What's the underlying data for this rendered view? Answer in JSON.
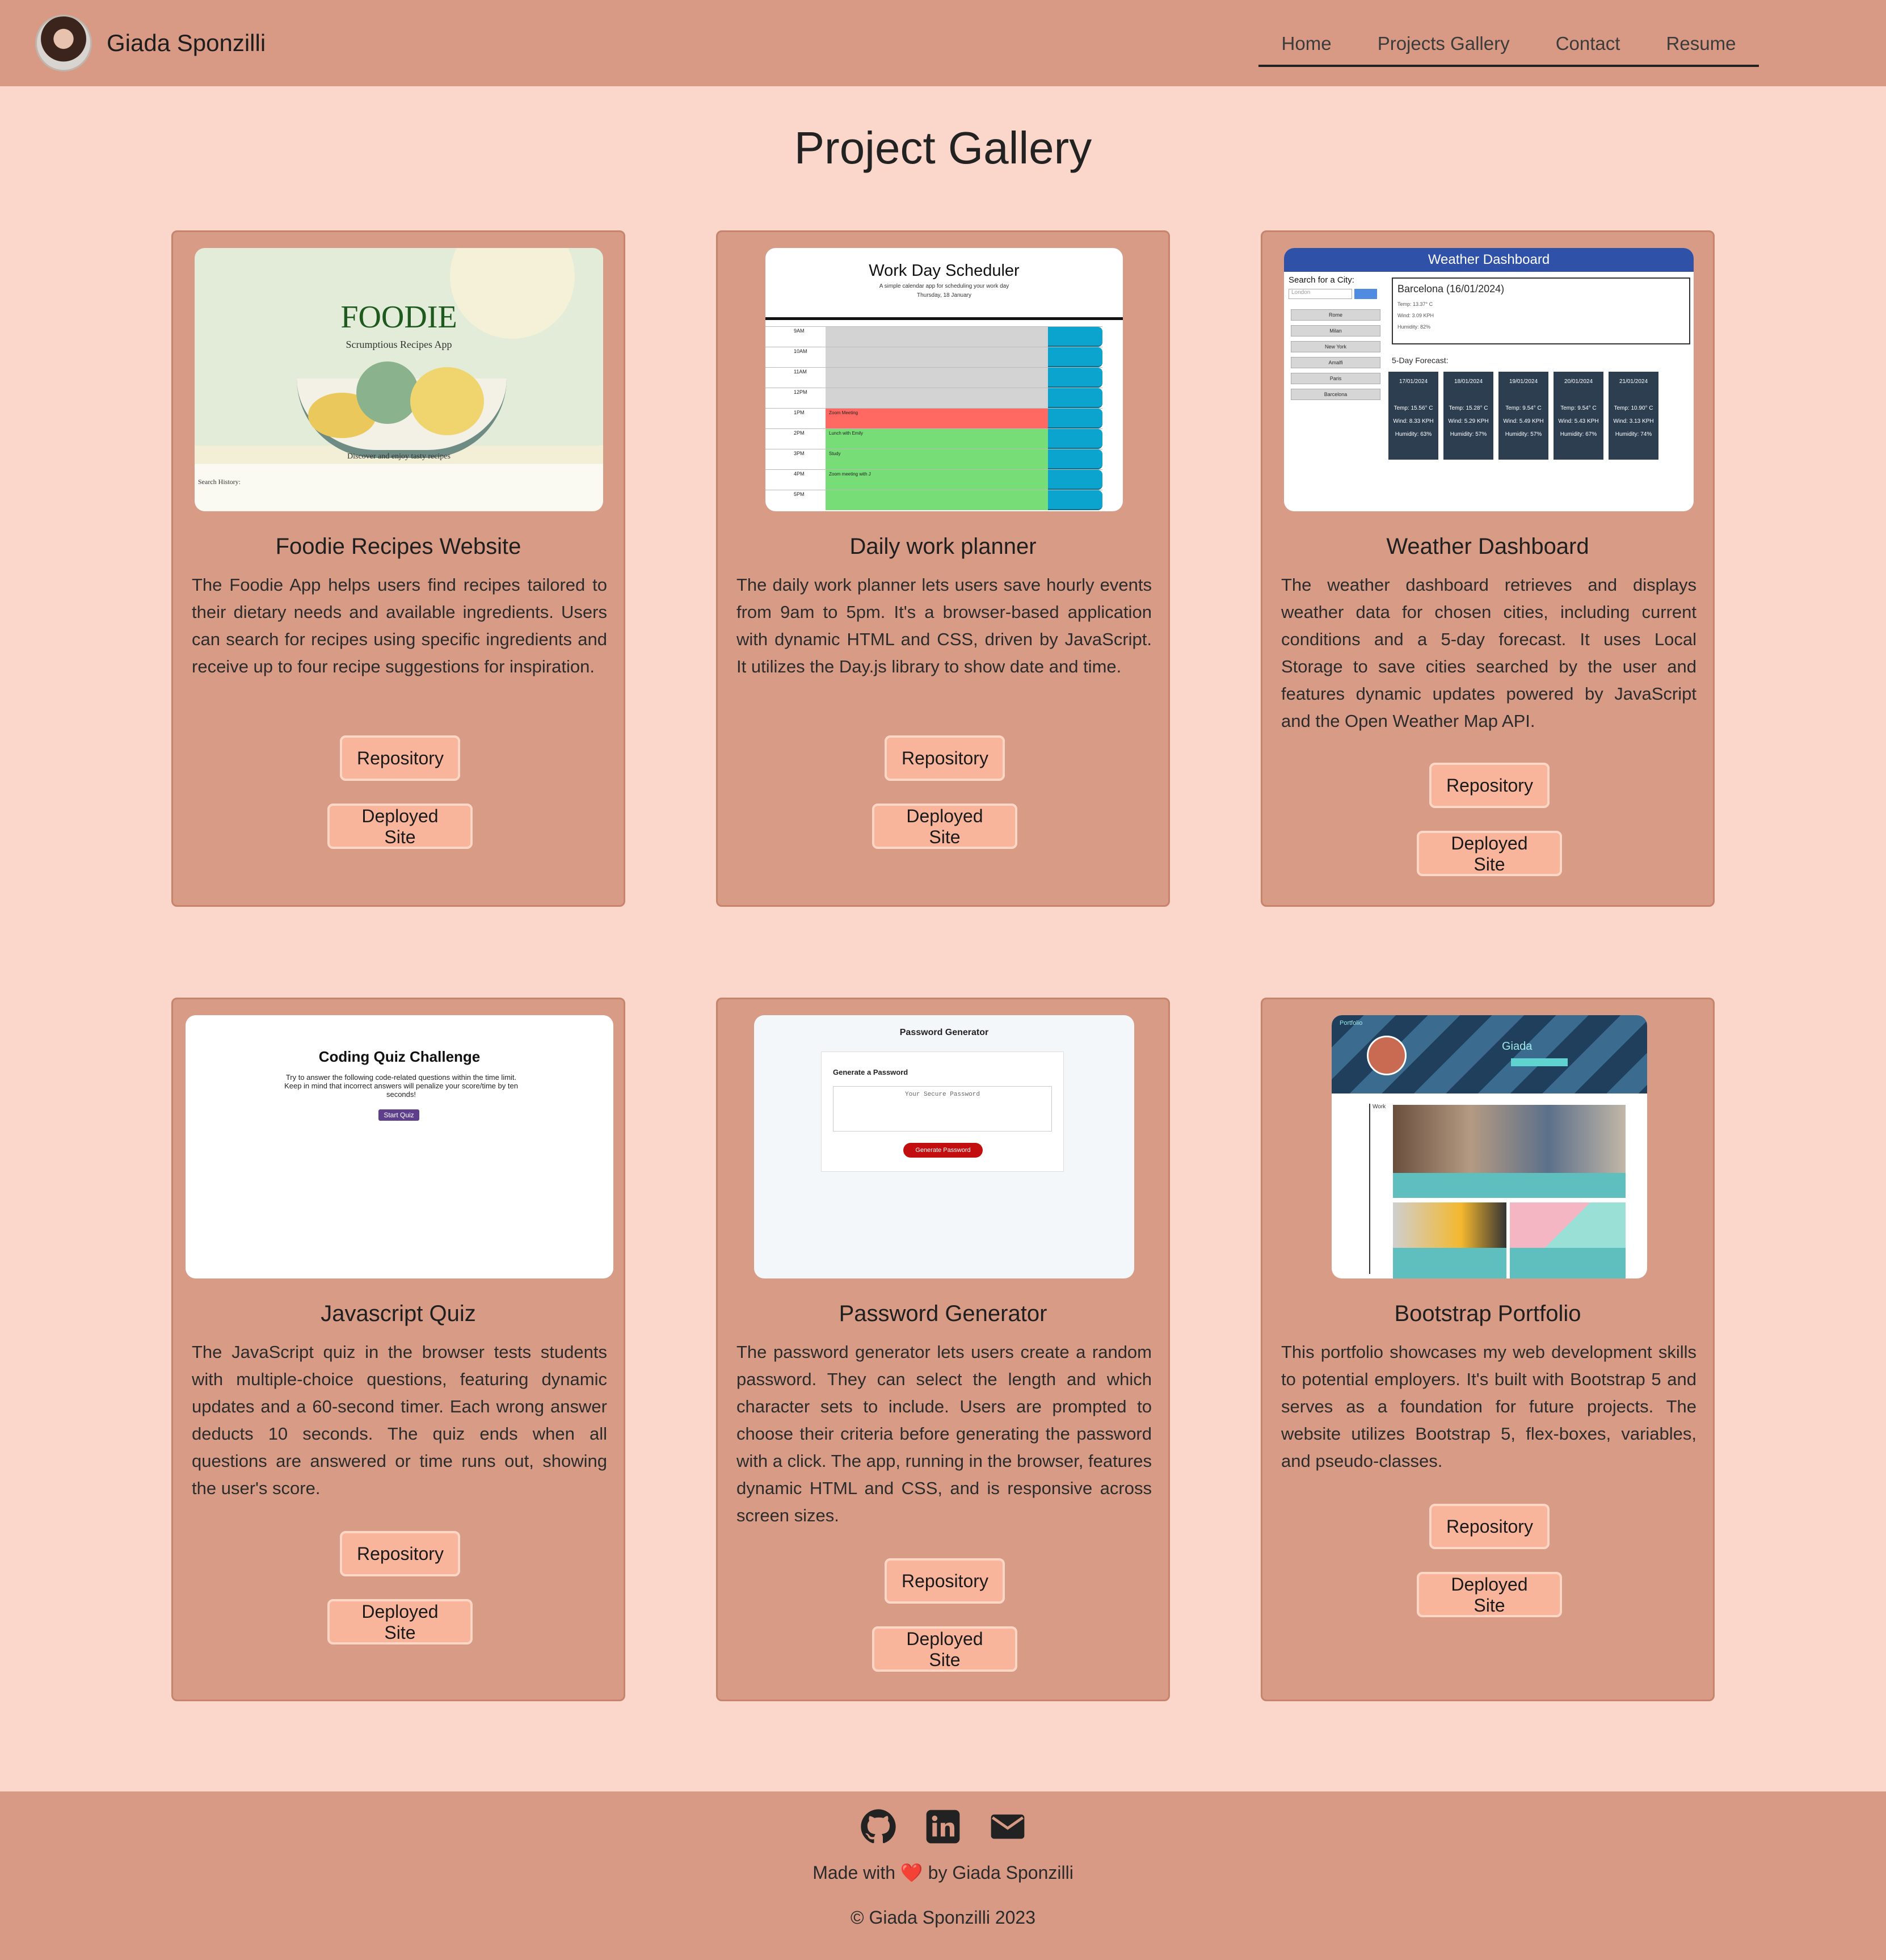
{
  "brand": {
    "name": "Giada Sponzilli"
  },
  "nav": {
    "items": [
      {
        "label": "Home"
      },
      {
        "label": "Projects Gallery"
      },
      {
        "label": "Contact"
      },
      {
        "label": "Resume"
      }
    ]
  },
  "page": {
    "title": "Project Gallery"
  },
  "projects": [
    {
      "title": "Foodie Recipes Website",
      "description": "The Foodie App helps users find recipes tailored to their dietary needs and available ingredients. Users can search for recipes using specific ingredients and receive up to four recipe suggestions for inspiration.",
      "repo_label": "Repository",
      "deploy_label": "Deployed Site",
      "preview": {
        "heading": "FOODIE",
        "subheading": "Scrumptious Recipes App",
        "tagline": "Discover and enjoy tasty recipes",
        "history_label": "Search History:"
      }
    },
    {
      "title": "Daily work planner",
      "description": "The daily work planner lets users save hourly events from 9am to 5pm. It's a browser-based application with dynamic HTML and CSS, driven by JavaScript. It utilizes the Day.js library to show date and time.",
      "repo_label": "Repository",
      "deploy_label": "Deployed Site",
      "preview": {
        "heading": "Work Day Scheduler",
        "subheading": "A simple calendar app for scheduling your work day",
        "date": "Thursday, 18 January",
        "rows": [
          {
            "hour": "9AM",
            "text": "",
            "color": "#d3d3d3"
          },
          {
            "hour": "10AM",
            "text": "",
            "color": "#d3d3d3"
          },
          {
            "hour": "11AM",
            "text": "",
            "color": "#d3d3d3"
          },
          {
            "hour": "12PM",
            "text": "",
            "color": "#d3d3d3"
          },
          {
            "hour": "1PM",
            "text": "Zoom Meeting",
            "color": "#ff6961"
          },
          {
            "hour": "2PM",
            "text": "Lunch with Emily",
            "color": "#77dd77"
          },
          {
            "hour": "3PM",
            "text": "Study",
            "color": "#77dd77"
          },
          {
            "hour": "4PM",
            "text": "Zoom meeting with J",
            "color": "#77dd77"
          },
          {
            "hour": "5PM",
            "text": "",
            "color": "#77dd77"
          }
        ]
      }
    },
    {
      "title": "Weather Dashboard",
      "description": "The weather dashboard retrieves and displays weather data for chosen cities, including current conditions and a 5-day forecast. It uses Local Storage to save cities searched by the user and features dynamic updates powered by JavaScript and the Open Weather Map API.",
      "repo_label": "Repository",
      "deploy_label": "Deployed Site",
      "preview": {
        "heading": "Weather Dashboard",
        "search_label": "Search for a City:",
        "search_placeholder": "London",
        "cities": [
          "Rome",
          "Milan",
          "New York",
          "Amalfi",
          "Paris",
          "Barcelona"
        ],
        "current": "Barcelona (16/01/2024)",
        "current_lines": [
          "Temp: 13.37° C",
          "Wind: 3.09 KPH",
          "Humidity: 82%"
        ],
        "forecast_label": "5-Day Forecast:",
        "forecast": [
          {
            "date": "17/01/2024",
            "temp": "Temp: 15.56° C",
            "wind": "Wind: 8.33 KPH",
            "humidity": "Humidity: 63%"
          },
          {
            "date": "18/01/2024",
            "temp": "Temp: 15.28° C",
            "wind": "Wind: 5.29 KPH",
            "humidity": "Humidity: 57%"
          },
          {
            "date": "19/01/2024",
            "temp": "Temp: 9.54° C",
            "wind": "Wind: 5.49 KPH",
            "humidity": "Humidity: 57%"
          },
          {
            "date": "20/01/2024",
            "temp": "Temp: 9.54° C",
            "wind": "Wind: 5.43 KPH",
            "humidity": "Humidity: 67%"
          },
          {
            "date": "21/01/2024",
            "temp": "Temp: 10.90° C",
            "wind": "Wind: 3.13 KPH",
            "humidity": "Humidity: 74%"
          }
        ]
      }
    },
    {
      "title": "Javascript Quiz",
      "description": "The JavaScript quiz in the browser tests students with multiple-choice questions, featuring dynamic updates and a 60-second timer. Each wrong answer deducts 10 seconds. The quiz ends when all questions are answered or time runs out, showing the user's score.",
      "repo_label": "Repository",
      "deploy_label": "Deployed Site",
      "preview": {
        "heading": "Coding Quiz Challenge",
        "text": "Try to answer the following code-related questions within the time limit. Keep in mind that incorrect answers will penalize your score/time by ten seconds!",
        "button": "Start Quiz"
      }
    },
    {
      "title": "Password Generator",
      "description": "The password generator lets users create a random password. They can select the length and which character sets to include. Users are prompted to choose their criteria before generating the password with a click. The app, running in the browser, features dynamic HTML and CSS, and is responsive across screen sizes.",
      "repo_label": "Repository",
      "deploy_label": "Deployed Site",
      "preview": {
        "heading": "Password Generator",
        "card_label": "Generate a Password",
        "placeholder": "Your Secure Password",
        "button": "Generate Password"
      }
    },
    {
      "title": "Bootstrap Portfolio",
      "description": "This portfolio showcases my web development skills to potential employers. It's built with Bootstrap 5 and serves as a foundation for future projects. The website utilizes Bootstrap 5, flex-boxes, variables, and pseudo-classes.",
      "repo_label": "Repository",
      "deploy_label": "Deployed Site",
      "preview": {
        "brand": "Portfolio",
        "name": "Giada",
        "work_label": "Work"
      }
    }
  ],
  "footer": {
    "icons": [
      "github-icon",
      "linkedin-icon",
      "email-icon"
    ],
    "made_prefix": "Made with",
    "made_heart": "❤️",
    "made_suffix": "by Giada Sponzilli",
    "copyright": "© Giada Sponzilli 2023"
  },
  "colors": {
    "page_bg": "#fbd7cb",
    "nav_bg": "#d89a85",
    "card_bg": "#d79b86",
    "button_bg": "#f9b59c"
  }
}
